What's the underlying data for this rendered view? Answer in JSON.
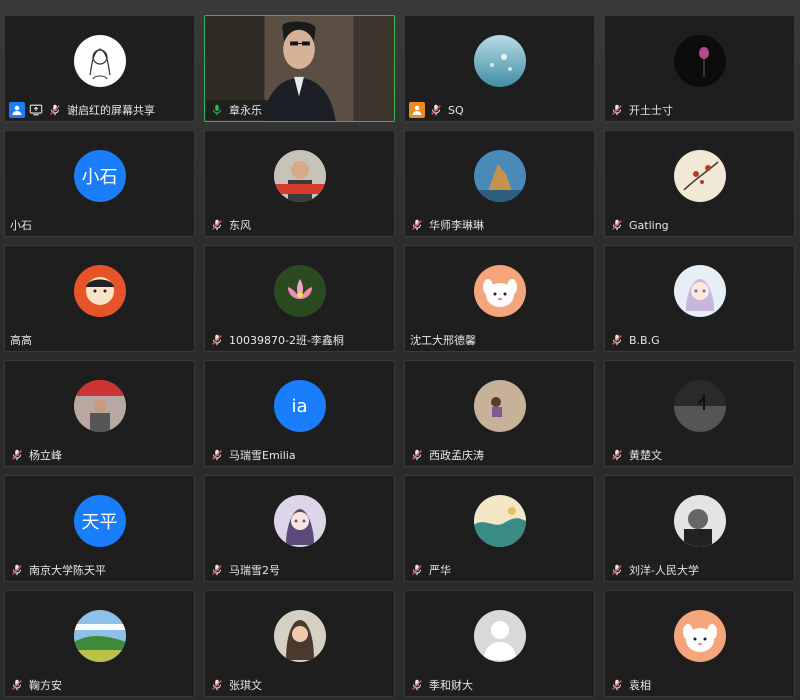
{
  "colors": {
    "active_border": "#2fb35b",
    "text_avatar_bg": "#1a7dfc",
    "tile_bg": "#1e1e1e",
    "muted_mic": "#e05555",
    "speaking_mic": "#2fb35b"
  },
  "participants": [
    {
      "name": "谢启红的屏幕共享",
      "avatar_type": "image",
      "avatar_icon": "cartoon-girl-avatar",
      "mic": "muted",
      "badges": [
        "user-icon",
        "screen-share-icon"
      ]
    },
    {
      "name": "章永乐",
      "avatar_type": "video",
      "avatar_icon": "live-video",
      "mic": "speaking",
      "badges": [],
      "active": true
    },
    {
      "name": "SQ",
      "avatar_type": "image",
      "avatar_icon": "sparkle-water-avatar",
      "mic": "muted",
      "badges": [
        "host-user-icon"
      ]
    },
    {
      "name": "开土士寸",
      "avatar_type": "image",
      "avatar_icon": "lotus-dark-avatar",
      "mic": "muted",
      "badges": []
    },
    {
      "name": "小石",
      "avatar_type": "text",
      "avatar_text": "小石",
      "mic": "none",
      "badges": []
    },
    {
      "name": "东风",
      "avatar_type": "image",
      "avatar_icon": "man-photo-avatar",
      "mic": "muted",
      "badges": []
    },
    {
      "name": "华师李琳琳",
      "avatar_type": "image",
      "avatar_icon": "rock-landscape-avatar",
      "mic": "muted",
      "badges": []
    },
    {
      "name": "Gatling",
      "avatar_type": "image",
      "avatar_icon": "flower-painting-avatar",
      "mic": "muted",
      "badges": []
    },
    {
      "name": "高高",
      "avatar_type": "image",
      "avatar_icon": "cartoon-girl-orange-avatar",
      "mic": "none",
      "badges": []
    },
    {
      "name": "10039870-2班-李鑫桐",
      "avatar_type": "image",
      "avatar_icon": "lotus-pink-avatar",
      "mic": "muted",
      "badges": []
    },
    {
      "name": "沈工大邢德馨",
      "avatar_type": "image",
      "avatar_icon": "puppy-cartoon-avatar",
      "mic": "none",
      "badges": []
    },
    {
      "name": "B.B.G",
      "avatar_type": "image",
      "avatar_icon": "anime-girl-avatar",
      "mic": "muted",
      "badges": []
    },
    {
      "name": "杨立峰",
      "avatar_type": "image",
      "avatar_icon": "person-photo-avatar",
      "mic": "muted",
      "badges": []
    },
    {
      "name": "马瑞雪Emilia",
      "avatar_type": "text",
      "avatar_text": "ia",
      "mic": "muted",
      "badges": []
    },
    {
      "name": "西政孟庆涛",
      "avatar_type": "image",
      "avatar_icon": "beach-person-avatar",
      "mic": "muted",
      "badges": []
    },
    {
      "name": "黄楚文",
      "avatar_type": "image",
      "avatar_icon": "dark-silhouette-avatar",
      "mic": "muted",
      "badges": []
    },
    {
      "name": "南京大学陈天平",
      "avatar_type": "text",
      "avatar_text": "天平",
      "mic": "muted",
      "badges": []
    },
    {
      "name": "马瑞雪2号",
      "avatar_type": "image",
      "avatar_icon": "anime-purple-avatar",
      "mic": "muted",
      "badges": []
    },
    {
      "name": "严华",
      "avatar_type": "image",
      "avatar_icon": "teal-illustration-avatar",
      "mic": "muted",
      "badges": []
    },
    {
      "name": "刘洋-人民大学",
      "avatar_type": "image",
      "avatar_icon": "bw-man-avatar",
      "mic": "muted",
      "badges": []
    },
    {
      "name": "鞠方安",
      "avatar_type": "image",
      "avatar_icon": "green-landscape-avatar",
      "mic": "muted",
      "badges": []
    },
    {
      "name": "张琪文",
      "avatar_type": "image",
      "avatar_icon": "woman-photo-avatar",
      "mic": "muted",
      "badges": []
    },
    {
      "name": "季和财大",
      "avatar_type": "image",
      "avatar_icon": "default-person-avatar",
      "mic": "muted",
      "badges": []
    },
    {
      "name": "袁相",
      "avatar_type": "image",
      "avatar_icon": "puppy-cartoon-avatar",
      "mic": "muted",
      "badges": []
    }
  ]
}
